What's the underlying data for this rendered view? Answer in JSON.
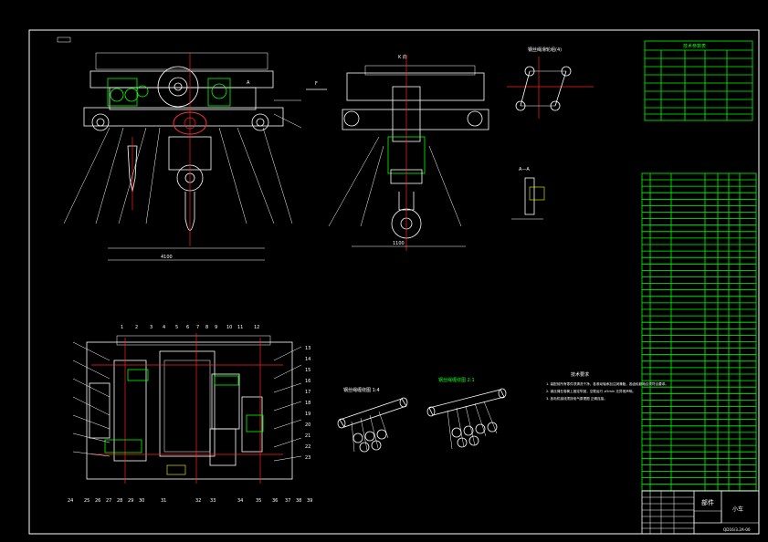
{
  "drawing": {
    "section_labels": {
      "k_view": "K 向",
      "a_view": "A 向",
      "a_a_section": "A—A",
      "pulley_diagram_title": "钢丝绳滑轮组(4)",
      "rope_diagram_1": "钢丝绳缠绕图 1:4",
      "rope_diagram_2": "钢丝绳缠绕图 2:1",
      "tech_requirements_title": "技术要求"
    },
    "tech_requirements": [
      "1. 装配前所有零件须清洗干净，各滚动轴承加注润滑脂，各齿轮副啮合须符合要求。",
      "2. 钢丝绳在卷筒上固定牢固，空载运行 ≥5min 无异常声响。",
      "3. 各电机接线须按电气原理图 正确连接。"
    ],
    "params_table": {
      "title": "技术参数表"
    },
    "title_block": {
      "name": "部件",
      "designation": "小车",
      "drawing_no": "QD16/3.2A-00"
    },
    "balloons_top_row": [
      "1",
      "2",
      "3",
      "4",
      "5",
      "6",
      "7",
      "8",
      "9",
      "10",
      "11",
      "12"
    ],
    "balloons_right_col": [
      "13",
      "14",
      "15",
      "16",
      "17",
      "18",
      "19",
      "20",
      "21",
      "22",
      "23"
    ],
    "balloons_bottom_row": [
      "24",
      "25",
      "26",
      "27",
      "28",
      "29",
      "30",
      "31",
      "32",
      "33",
      "34",
      "35",
      "36",
      "37",
      "38",
      "39"
    ],
    "dimension_a": "A",
    "dimension_f": "F"
  }
}
